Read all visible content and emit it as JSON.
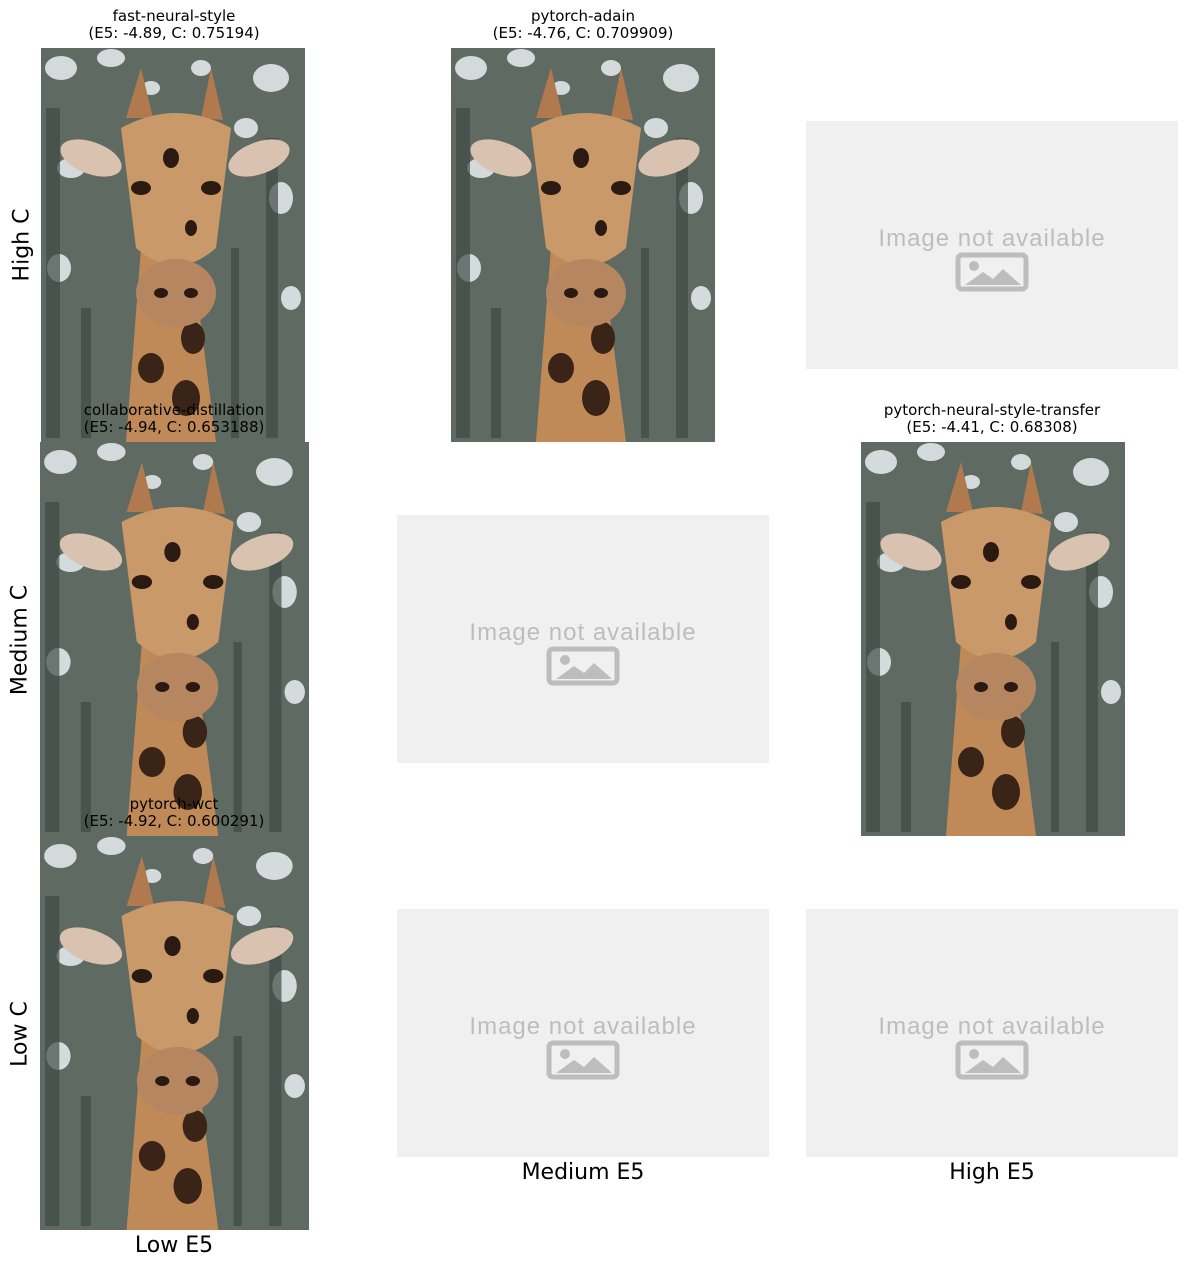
{
  "cells": {
    "fast_neural_style": {
      "name": "fast-neural-style",
      "scores": "(E5: -4.89, C: 0.75194)"
    },
    "pytorch_adain": {
      "name": "pytorch-adain",
      "scores": "(E5: -4.76, C: 0.709909)"
    },
    "collaborative_distillation": {
      "name": "collaborative-distillation",
      "scores": "(E5: -4.94, C: 0.653188)"
    },
    "pytorch_neural_style_transfer": {
      "name": "pytorch-neural-style-transfer",
      "scores": "(E5: -4.41, C: 0.68308)"
    },
    "pytorch_wct": {
      "name": "pytorch-wct",
      "scores": "(E5: -4.92, C: 0.600291)"
    }
  },
  "row_labels": {
    "high": "High C",
    "medium": "Medium C",
    "low": "Low C"
  },
  "col_labels": {
    "low": "Low E5",
    "medium": "Medium E5",
    "high": "High E5"
  },
  "placeholder": {
    "text": "Image not available",
    "icon": "image-placeholder-icon"
  },
  "colors": {
    "placeholder_bg": "#f0f0f0",
    "placeholder_fg": "#bdbdbd",
    "giraffe_tan": "#c08a58",
    "giraffe_spot": "#3a2418",
    "foliage": "#5b6b5e",
    "sky": "#dfe6ee",
    "accent_red": "#c9553a"
  }
}
